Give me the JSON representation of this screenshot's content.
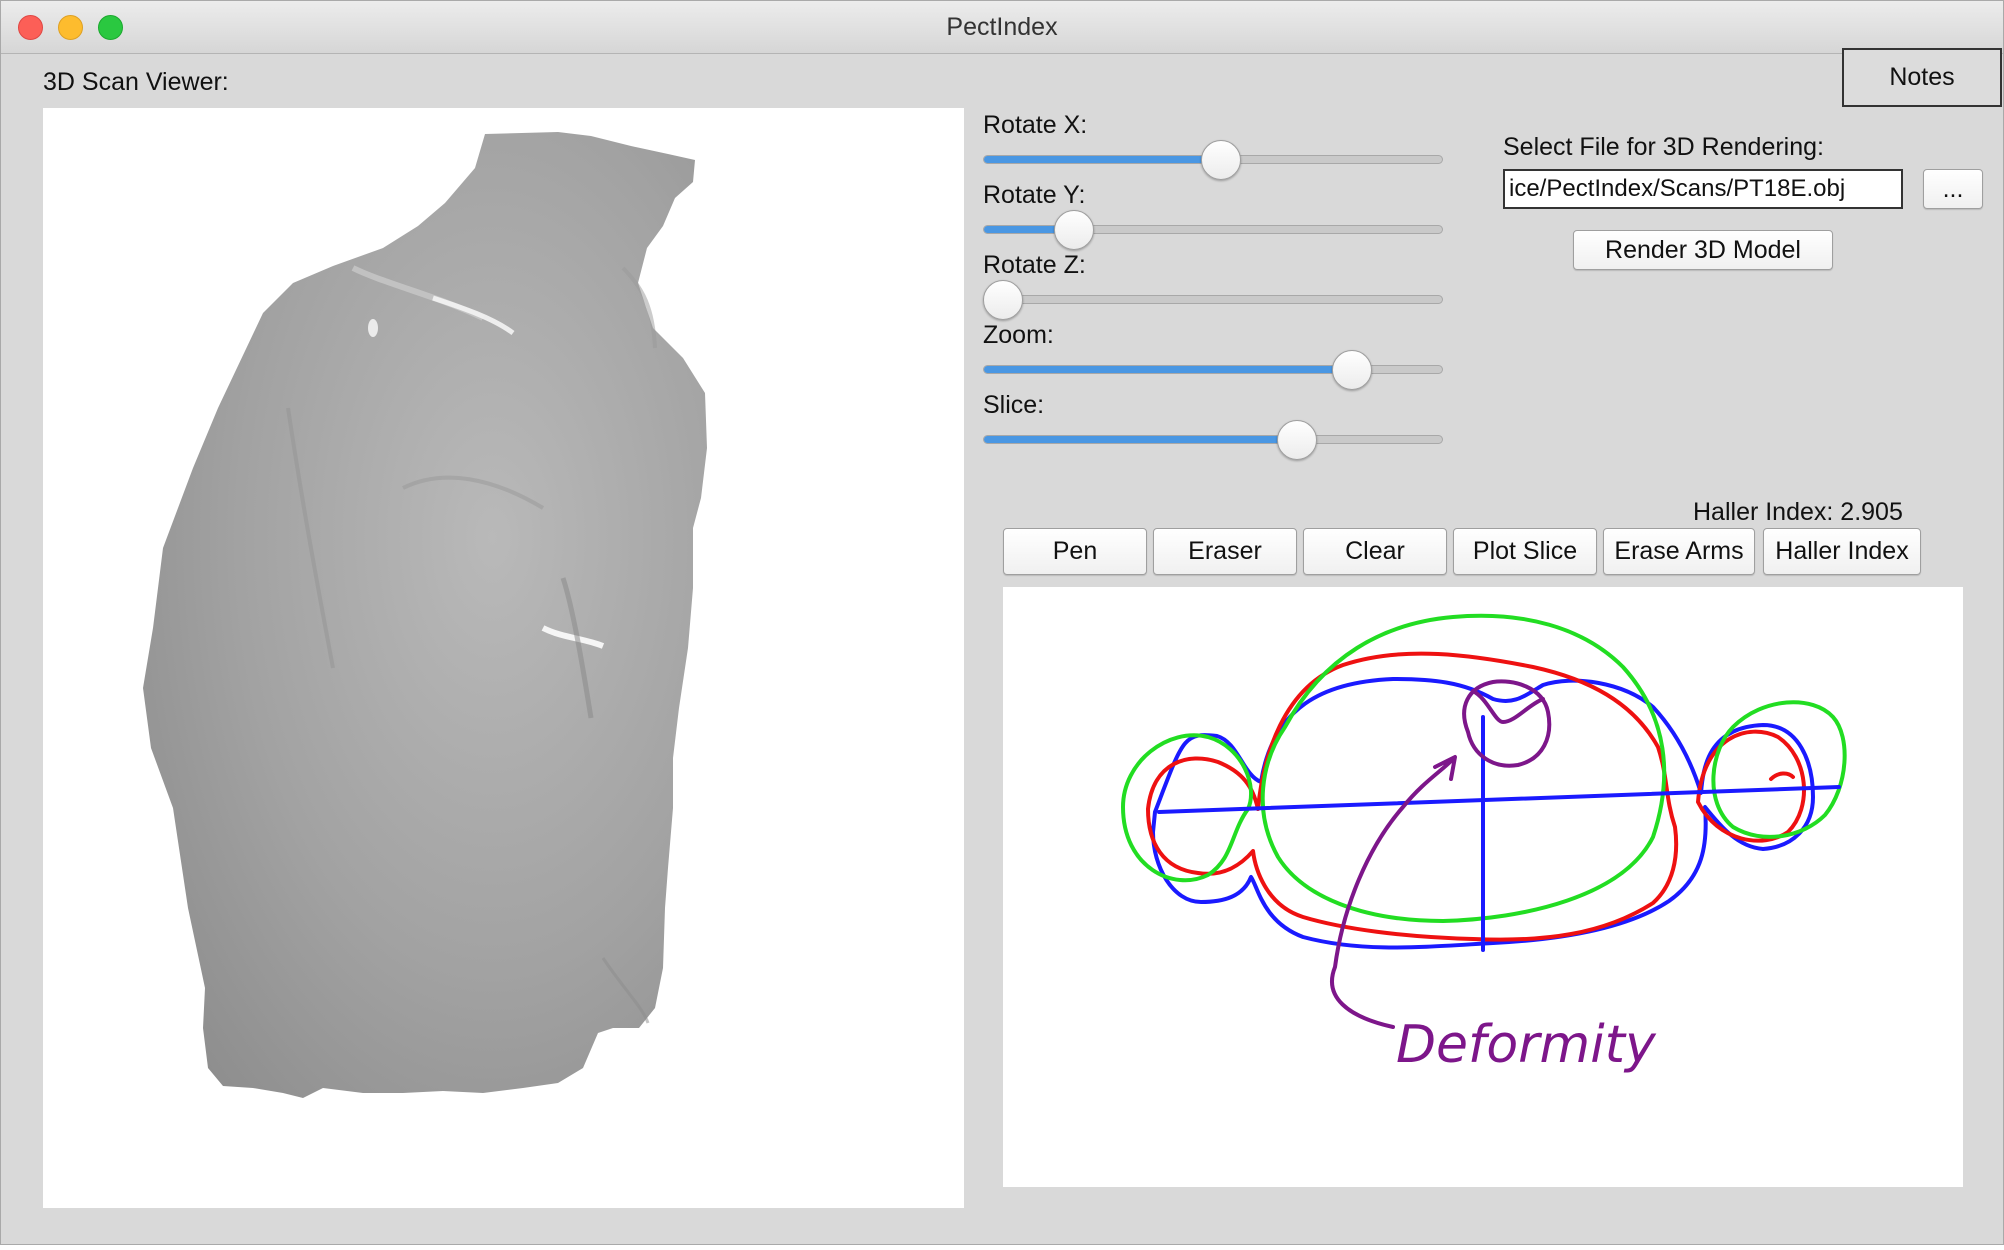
{
  "window": {
    "title": "PectIndex"
  },
  "viewer": {
    "label": "3D Scan Viewer:"
  },
  "notes": {
    "label": "Notes"
  },
  "sliders": [
    {
      "label": "Rotate X:",
      "value": 0.52
    },
    {
      "label": "Rotate Y:",
      "value": 0.17
    },
    {
      "label": "Rotate Z:",
      "value": 0.0
    },
    {
      "label": "Zoom:",
      "value": 0.83
    },
    {
      "label": "Slice:",
      "value": 0.7
    }
  ],
  "file": {
    "label": "Select File for 3D Rendering:",
    "value": "ice/PectIndex/Scans/PT18E.obj",
    "browse_label": "...",
    "render_label": "Render 3D Model"
  },
  "haller": {
    "label": "Haller Index: 2.905"
  },
  "toolbar": {
    "pen": "Pen",
    "eraser": "Eraser",
    "clear": "Clear",
    "plot_slice": "Plot Slice",
    "erase_arms": "Erase Arms",
    "haller_index": "Haller Index"
  },
  "drawing": {
    "annotation": "Deformity",
    "colors": {
      "blue": "#1a1aff",
      "red": "#ee1111",
      "green": "#22dd22",
      "purple": "#7d168a"
    }
  },
  "colors": {
    "slider_fill": "#4a97e3",
    "window_bg": "#d9d9d9"
  }
}
